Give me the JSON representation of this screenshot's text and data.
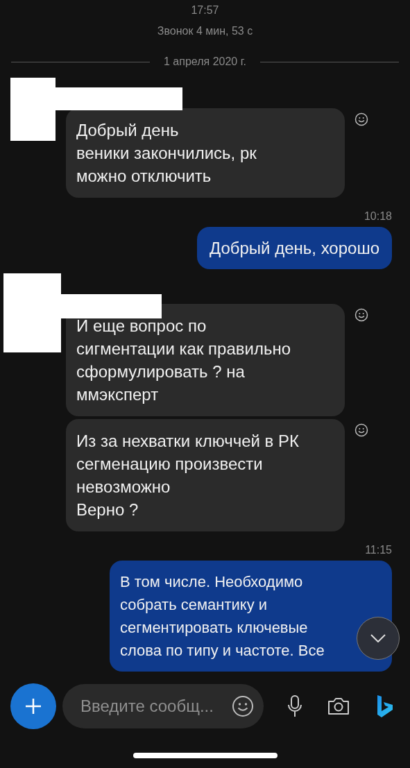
{
  "call_info": {
    "time": "17:57",
    "summary": "Звонок 4 мин, 53 с"
  },
  "date_separator": "1 апреля 2020 г.",
  "messages": [
    {
      "kind": "incoming",
      "redacted": true,
      "bubbles": [
        {
          "text": "Добрый день\nвеники закончились, рк\nможно отключить"
        }
      ]
    },
    {
      "kind": "outgoing",
      "time": "10:18",
      "bubbles": [
        {
          "text": "Добрый день, хорошо"
        }
      ]
    },
    {
      "kind": "incoming",
      "redacted": true,
      "bubbles": [
        {
          "text": "И еще вопрос по\nсигментации как правильно\nсформулировать ? на\nммэксперт"
        },
        {
          "text": "Из за нехватки ключчей в РК\nсегменацию произвести\nневозможно\nВерно ?"
        }
      ]
    },
    {
      "kind": "outgoing",
      "time": "11:15",
      "bubbles": [
        {
          "text": "В том числе. Необходимо\nсобрать семантику и\nсегментировать ключевые\nслова по типу и частоте. Все"
        }
      ]
    }
  ],
  "composer": {
    "placeholder": "Введите сообщ..."
  }
}
